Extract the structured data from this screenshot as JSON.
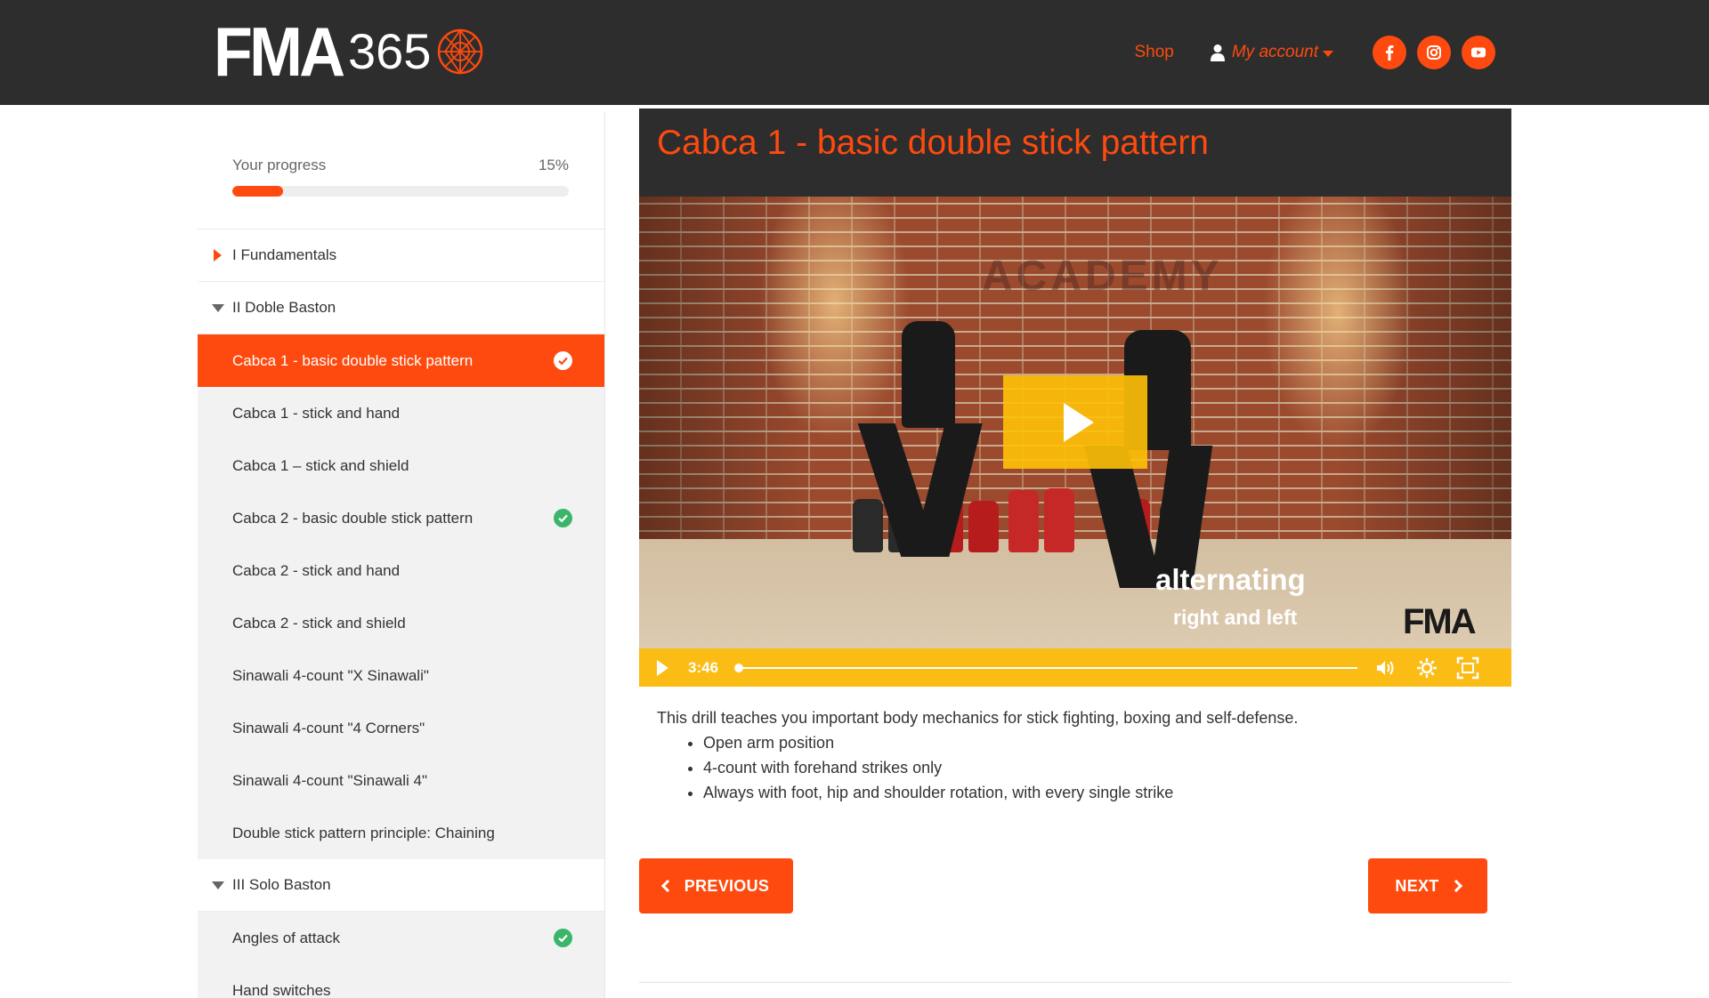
{
  "brand": {
    "logo_main": "FMA",
    "logo_number": "365"
  },
  "nav": {
    "shop": "Shop",
    "account": "My account",
    "socials": [
      "facebook-icon",
      "instagram-icon",
      "youtube-icon"
    ]
  },
  "progress": {
    "label": "Your progress",
    "value_text": "15%",
    "value": 0.15
  },
  "sidebar": {
    "sections": [
      {
        "label": "I Fundamentals",
        "state": "collapsed"
      },
      {
        "label": "II Doble Baston",
        "state": "expanded"
      },
      {
        "label": "III Solo Baston",
        "state": "expanded"
      }
    ],
    "doble_baston_lessons": [
      {
        "label": "Cabca 1 - basic double stick pattern",
        "active": true,
        "completed": true
      },
      {
        "label": "Cabca 1 - stick and hand",
        "active": false,
        "completed": false
      },
      {
        "label": "Cabca 1 – stick and shield",
        "active": false,
        "completed": false
      },
      {
        "label": "Cabca 2 - basic double stick pattern",
        "active": false,
        "completed": true
      },
      {
        "label": "Cabca 2 - stick and hand",
        "active": false,
        "completed": false
      },
      {
        "label": "Cabca 2 - stick and shield",
        "active": false,
        "completed": false
      },
      {
        "label": "Sinawali 4-count \"X Sinawali\"",
        "active": false,
        "completed": false
      },
      {
        "label": "Sinawali 4-count \"4 Corners\"",
        "active": false,
        "completed": false
      },
      {
        "label": "Sinawali 4-count \"Sinawali 4\"",
        "active": false,
        "completed": false
      },
      {
        "label": "Double stick pattern principle: Chaining",
        "active": false,
        "completed": false
      }
    ],
    "solo_baston_lessons": [
      {
        "label": "Angles of attack",
        "active": false,
        "completed": true
      },
      {
        "label": "Hand switches",
        "active": false,
        "completed": false
      }
    ]
  },
  "lesson": {
    "title": "Cabca 1 - basic double stick pattern",
    "video": {
      "watermark": "ACADEMY",
      "overlay_line1": "alternating",
      "overlay_line2": "right and left",
      "corner_mark": "FMA",
      "time": "3:46",
      "progress": 0.0
    },
    "description": "This drill teaches you important body mechanics for stick fighting, boxing and self-defense.",
    "bullets": [
      "Open arm position",
      "4-count with forehand strikes only",
      "Always with foot, hip and shoulder rotation, with every single strike"
    ],
    "prev_label": "PREVIOUS",
    "next_label": "NEXT"
  },
  "colors": {
    "accent": "#fe4a0f",
    "header_bg": "#2d2d2d",
    "video_controls": "#fbbc16",
    "check_green": "#3bb56a"
  }
}
